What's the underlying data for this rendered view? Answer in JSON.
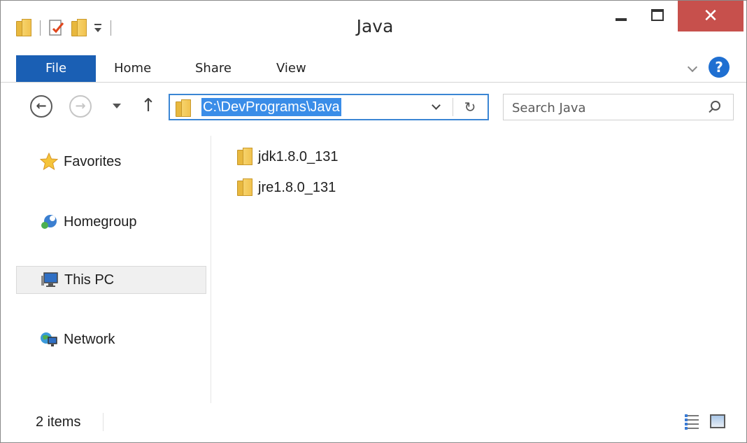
{
  "window": {
    "title": "Java",
    "close_glyph": "✕"
  },
  "ribbon": {
    "tabs": [
      {
        "label": "File"
      },
      {
        "label": "Home"
      },
      {
        "label": "Share"
      },
      {
        "label": "View"
      }
    ],
    "help_glyph": "?"
  },
  "address": {
    "path": "C:\\DevPrograms\\Java",
    "refresh_glyph": "↻"
  },
  "search": {
    "placeholder": "Search Java"
  },
  "nav": {
    "up_glyph": "↑",
    "back_glyph": "←",
    "forward_glyph": "→"
  },
  "sidebar": {
    "items": [
      {
        "label": "Favorites",
        "icon": "star-icon"
      },
      {
        "label": "Homegroup",
        "icon": "homegroup-icon"
      },
      {
        "label": "This PC",
        "icon": "computer-icon",
        "selected": true
      },
      {
        "label": "Network",
        "icon": "network-icon"
      }
    ]
  },
  "files": [
    {
      "name": "jdk1.8.0_131",
      "icon": "folder-icon"
    },
    {
      "name": "jre1.8.0_131",
      "icon": "folder-icon"
    }
  ],
  "status": {
    "count": "2 items"
  },
  "colors": {
    "file_tab": "#1a5fb4",
    "close_button": "#c7504c",
    "address_highlight": "#3a8de8",
    "help": "#1f6fd1"
  }
}
